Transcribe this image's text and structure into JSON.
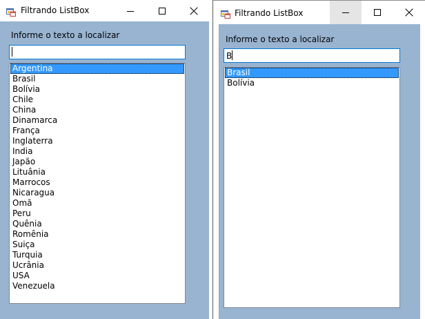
{
  "windows": [
    {
      "title": "Filtrando ListBox",
      "prompt_label": "Informe o texto a localizar",
      "search_value": "",
      "items": [
        "Argentina",
        "Brasil",
        "Bolívia",
        "Chile",
        "China",
        "Dinamarca",
        "França",
        "Inglaterra",
        "India",
        "Japão",
        "Lituânia",
        "Marrocos",
        "Nicaragua",
        "Omã",
        "Peru",
        "Quênia",
        "Romênia",
        "Suiça",
        "Turquia",
        "Ucrânia",
        "USA",
        "Venezuela"
      ],
      "selected_index": 0
    },
    {
      "title": "Filtrando ListBox",
      "prompt_label": "Informe o texto a localizar",
      "search_value": "B",
      "items": [
        "Brasil",
        "Bolívia"
      ],
      "selected_index": 0
    }
  ],
  "icons": {
    "app": "winforms-app-icon",
    "minimize": "minimize-icon",
    "maximize": "maximize-icon",
    "close": "close-icon"
  },
  "colors": {
    "client_background": "#99b4d1",
    "selection": "#3399ff",
    "focus_border": "#0078d7"
  }
}
